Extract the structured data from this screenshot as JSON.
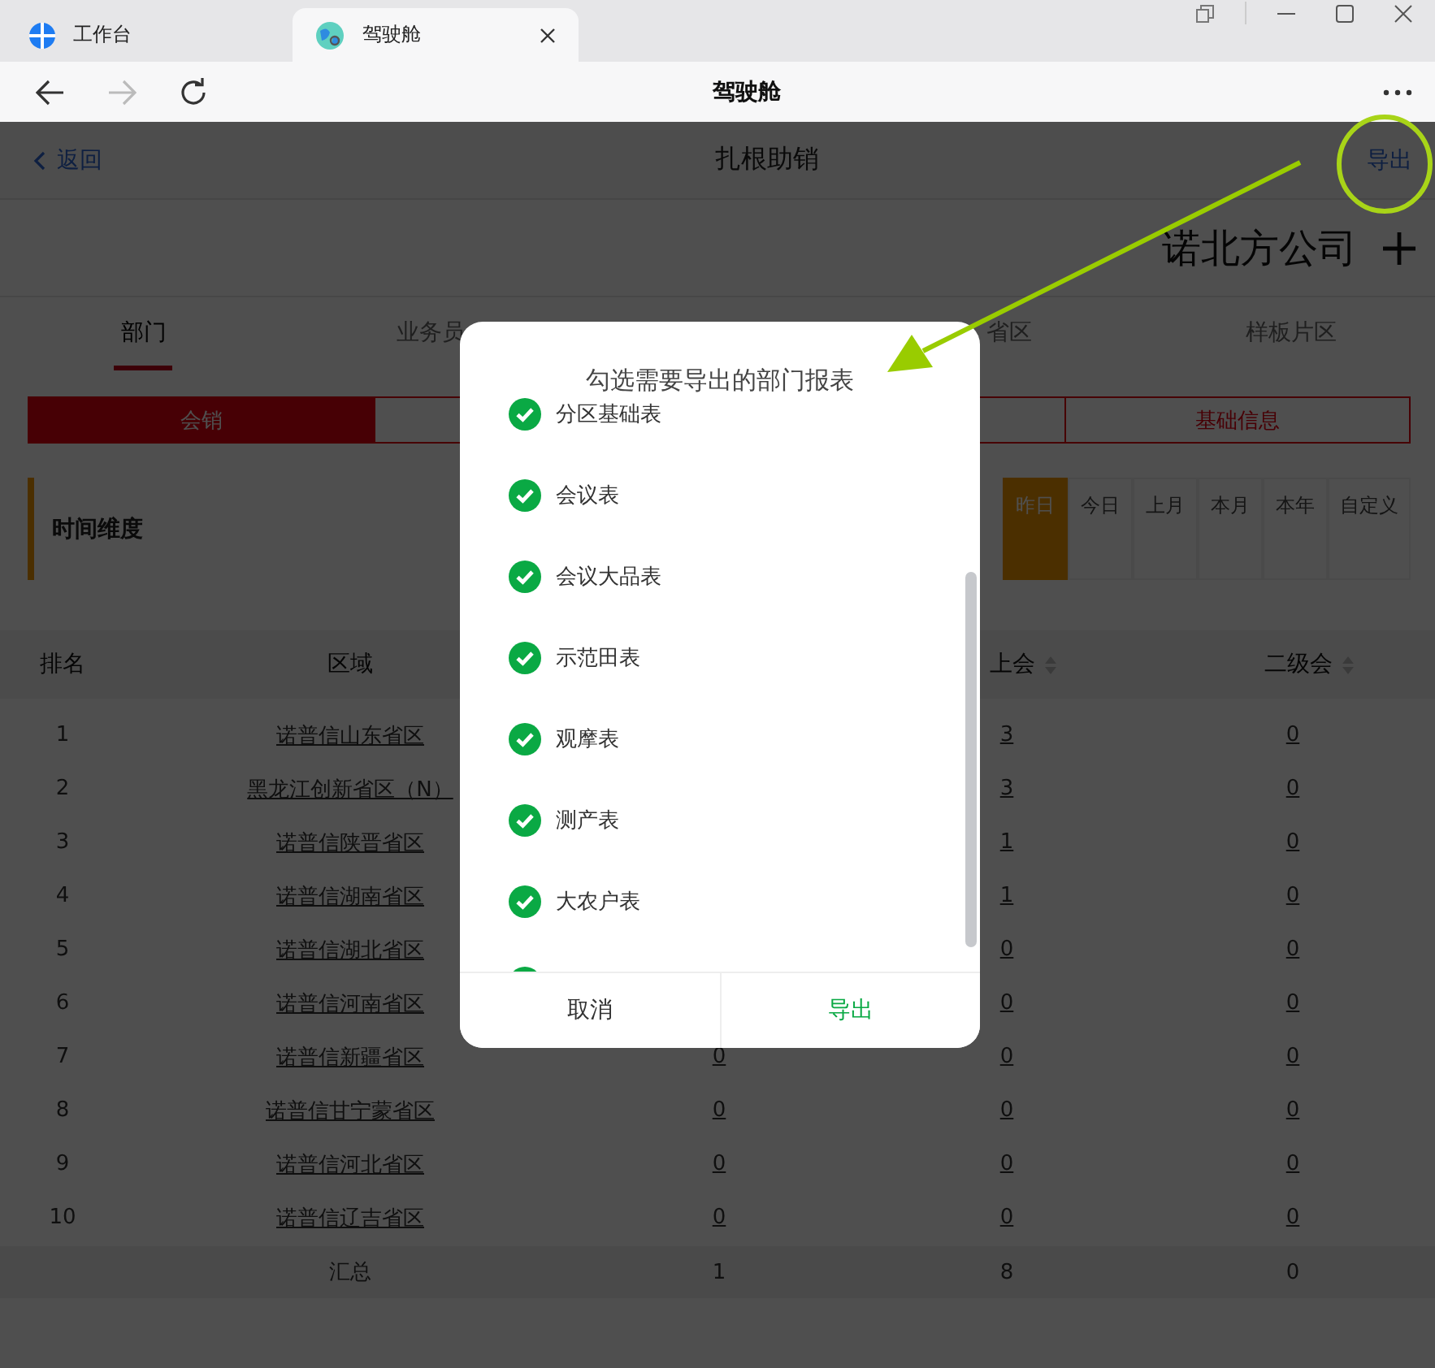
{
  "browser": {
    "tabs": [
      {
        "label": "工作台",
        "selected": false
      },
      {
        "label": "驾驶舱",
        "selected": true
      }
    ],
    "page_title": "驾驶舱",
    "forward_disabled": true
  },
  "header": {
    "back": "返回",
    "title": "扎根助销",
    "export": "导出"
  },
  "company": {
    "name": "诺北方公司"
  },
  "tabs": [
    {
      "label": "部门",
      "selected": true
    },
    {
      "label": "业务员",
      "selected": false
    },
    {
      "label": "省区",
      "selected": false
    },
    {
      "label": "样板片区",
      "selected": false
    }
  ],
  "segments": [
    {
      "label": "会销",
      "selected": true
    },
    {
      "selected": false
    },
    {
      "selected": false
    },
    {
      "label": "基础信息",
      "selected": false
    }
  ],
  "time": {
    "label": "时间维度",
    "options": [
      {
        "label": "昨日",
        "selected": true
      },
      {
        "label": "今日",
        "selected": false
      },
      {
        "label": "上月",
        "selected": false
      },
      {
        "label": "本月",
        "selected": false
      },
      {
        "label": "本年",
        "selected": false
      },
      {
        "label": "自定义",
        "selected": false
      }
    ]
  },
  "table": {
    "columns": [
      {
        "label": "排名",
        "sortable": false
      },
      {
        "label": "区域",
        "sortable": false
      },
      null,
      {
        "label": "上会",
        "sortable": true
      },
      {
        "label": "二级会",
        "sortable": true
      }
    ],
    "rows": [
      [
        "1",
        "诺普信山东省区",
        null,
        "3",
        "0"
      ],
      [
        "2",
        "黑龙江创新省区（N）",
        null,
        "3",
        "0"
      ],
      [
        "3",
        "诺普信陕晋省区",
        null,
        "1",
        "0"
      ],
      [
        "4",
        "诺普信湖南省区",
        null,
        "1",
        "0"
      ],
      [
        "5",
        "诺普信湖北省区",
        null,
        "0",
        "0"
      ],
      [
        "6",
        "诺普信河南省区",
        null,
        "0",
        "0"
      ],
      [
        "7",
        "诺普信新疆省区",
        "0",
        "0",
        "0"
      ],
      [
        "8",
        "诺普信甘宁蒙省区",
        "0",
        "0",
        "0"
      ],
      [
        "9",
        "诺普信河北省区",
        "0",
        "0",
        "0"
      ],
      [
        "10",
        "诺普信辽吉省区",
        "0",
        "0",
        "0"
      ]
    ],
    "total": {
      "label": "汇总",
      "values": [
        "1",
        "8",
        "0"
      ]
    }
  },
  "dialog": {
    "title": "勾选需要导出的部门报表",
    "items": [
      {
        "label": "分区基础表",
        "checked": true
      },
      {
        "label": "会议表",
        "checked": true
      },
      {
        "label": "会议大品表",
        "checked": true
      },
      {
        "label": "示范田表",
        "checked": true
      },
      {
        "label": "观摩表",
        "checked": true
      },
      {
        "label": "测产表",
        "checked": true
      },
      {
        "label": "大农户表",
        "checked": true
      },
      {
        "checked": true
      }
    ],
    "buttons": [
      {
        "label": "取消",
        "kind": "cancel"
      },
      {
        "label": "导出",
        "kind": "confirm"
      }
    ]
  }
}
